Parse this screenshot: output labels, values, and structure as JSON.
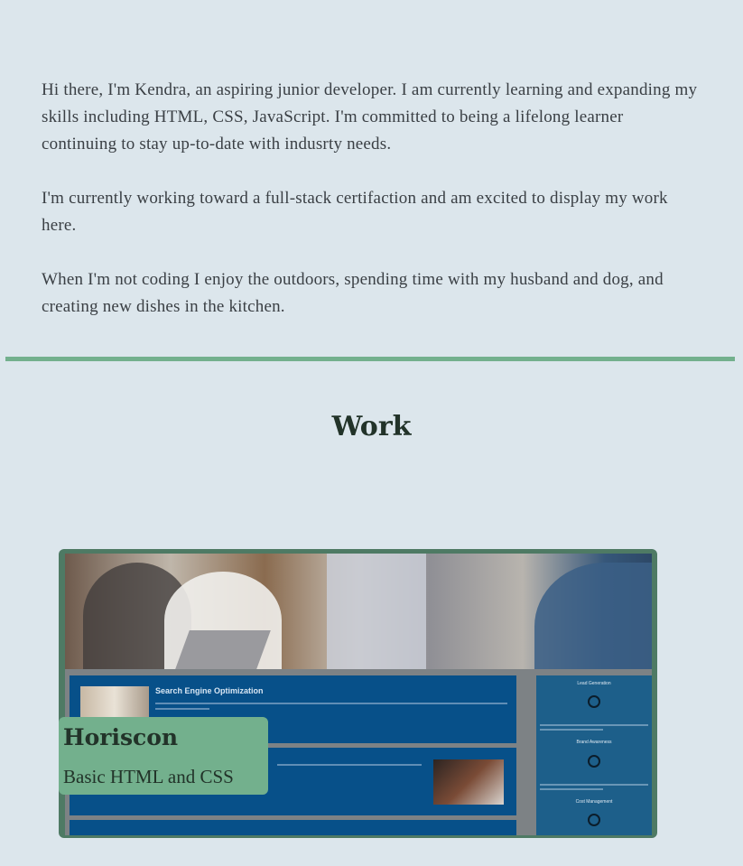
{
  "about": {
    "paragraphs": [
      "Hi there, I'm Kendra, an aspiring junior developer. I am currently learning and expanding my skills including HTML, CSS, JavaScript. I'm committed to being a lifelong learner continuing to stay up-to-date with indusrty needs.",
      "I'm currently working toward a full-stack certifaction and am excited to display my work here.",
      "When I'm not coding I enjoy the outdoors, spending time with my husband and dog, and creating new dishes in the kitchen."
    ]
  },
  "work": {
    "title": "Work",
    "projects": [
      {
        "name": "Horiscon",
        "description": "Basic HTML and CSS",
        "screenshot": {
          "panel_title": "Search Engine Optimization",
          "side_labels": [
            "Lead Generation",
            "Brand Awareness",
            "Cost Management"
          ]
        }
      }
    ]
  },
  "colors": {
    "background": "#dce6ec",
    "accent": "#73b08d",
    "card_border": "#4e7a64",
    "heading_text": "#223329"
  }
}
